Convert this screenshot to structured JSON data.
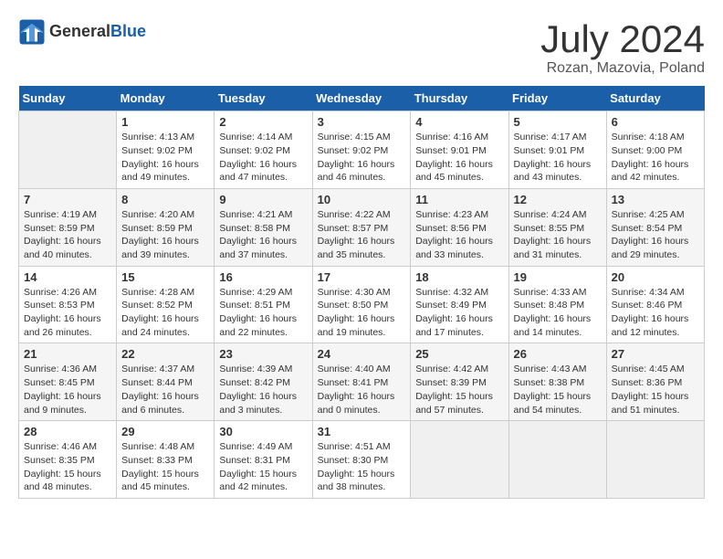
{
  "header": {
    "logo_general": "General",
    "logo_blue": "Blue",
    "month_title": "July 2024",
    "subtitle": "Rozan, Mazovia, Poland"
  },
  "weekdays": [
    "Sunday",
    "Monday",
    "Tuesday",
    "Wednesday",
    "Thursday",
    "Friday",
    "Saturday"
  ],
  "weeks": [
    [
      {
        "day": "",
        "info": ""
      },
      {
        "day": "1",
        "info": "Sunrise: 4:13 AM\nSunset: 9:02 PM\nDaylight: 16 hours\nand 49 minutes."
      },
      {
        "day": "2",
        "info": "Sunrise: 4:14 AM\nSunset: 9:02 PM\nDaylight: 16 hours\nand 47 minutes."
      },
      {
        "day": "3",
        "info": "Sunrise: 4:15 AM\nSunset: 9:02 PM\nDaylight: 16 hours\nand 46 minutes."
      },
      {
        "day": "4",
        "info": "Sunrise: 4:16 AM\nSunset: 9:01 PM\nDaylight: 16 hours\nand 45 minutes."
      },
      {
        "day": "5",
        "info": "Sunrise: 4:17 AM\nSunset: 9:01 PM\nDaylight: 16 hours\nand 43 minutes."
      },
      {
        "day": "6",
        "info": "Sunrise: 4:18 AM\nSunset: 9:00 PM\nDaylight: 16 hours\nand 42 minutes."
      }
    ],
    [
      {
        "day": "7",
        "info": "Sunrise: 4:19 AM\nSunset: 8:59 PM\nDaylight: 16 hours\nand 40 minutes."
      },
      {
        "day": "8",
        "info": "Sunrise: 4:20 AM\nSunset: 8:59 PM\nDaylight: 16 hours\nand 39 minutes."
      },
      {
        "day": "9",
        "info": "Sunrise: 4:21 AM\nSunset: 8:58 PM\nDaylight: 16 hours\nand 37 minutes."
      },
      {
        "day": "10",
        "info": "Sunrise: 4:22 AM\nSunset: 8:57 PM\nDaylight: 16 hours\nand 35 minutes."
      },
      {
        "day": "11",
        "info": "Sunrise: 4:23 AM\nSunset: 8:56 PM\nDaylight: 16 hours\nand 33 minutes."
      },
      {
        "day": "12",
        "info": "Sunrise: 4:24 AM\nSunset: 8:55 PM\nDaylight: 16 hours\nand 31 minutes."
      },
      {
        "day": "13",
        "info": "Sunrise: 4:25 AM\nSunset: 8:54 PM\nDaylight: 16 hours\nand 29 minutes."
      }
    ],
    [
      {
        "day": "14",
        "info": "Sunrise: 4:26 AM\nSunset: 8:53 PM\nDaylight: 16 hours\nand 26 minutes."
      },
      {
        "day": "15",
        "info": "Sunrise: 4:28 AM\nSunset: 8:52 PM\nDaylight: 16 hours\nand 24 minutes."
      },
      {
        "day": "16",
        "info": "Sunrise: 4:29 AM\nSunset: 8:51 PM\nDaylight: 16 hours\nand 22 minutes."
      },
      {
        "day": "17",
        "info": "Sunrise: 4:30 AM\nSunset: 8:50 PM\nDaylight: 16 hours\nand 19 minutes."
      },
      {
        "day": "18",
        "info": "Sunrise: 4:32 AM\nSunset: 8:49 PM\nDaylight: 16 hours\nand 17 minutes."
      },
      {
        "day": "19",
        "info": "Sunrise: 4:33 AM\nSunset: 8:48 PM\nDaylight: 16 hours\nand 14 minutes."
      },
      {
        "day": "20",
        "info": "Sunrise: 4:34 AM\nSunset: 8:46 PM\nDaylight: 16 hours\nand 12 minutes."
      }
    ],
    [
      {
        "day": "21",
        "info": "Sunrise: 4:36 AM\nSunset: 8:45 PM\nDaylight: 16 hours\nand 9 minutes."
      },
      {
        "day": "22",
        "info": "Sunrise: 4:37 AM\nSunset: 8:44 PM\nDaylight: 16 hours\nand 6 minutes."
      },
      {
        "day": "23",
        "info": "Sunrise: 4:39 AM\nSunset: 8:42 PM\nDaylight: 16 hours\nand 3 minutes."
      },
      {
        "day": "24",
        "info": "Sunrise: 4:40 AM\nSunset: 8:41 PM\nDaylight: 16 hours\nand 0 minutes."
      },
      {
        "day": "25",
        "info": "Sunrise: 4:42 AM\nSunset: 8:39 PM\nDaylight: 15 hours\nand 57 minutes."
      },
      {
        "day": "26",
        "info": "Sunrise: 4:43 AM\nSunset: 8:38 PM\nDaylight: 15 hours\nand 54 minutes."
      },
      {
        "day": "27",
        "info": "Sunrise: 4:45 AM\nSunset: 8:36 PM\nDaylight: 15 hours\nand 51 minutes."
      }
    ],
    [
      {
        "day": "28",
        "info": "Sunrise: 4:46 AM\nSunset: 8:35 PM\nDaylight: 15 hours\nand 48 minutes."
      },
      {
        "day": "29",
        "info": "Sunrise: 4:48 AM\nSunset: 8:33 PM\nDaylight: 15 hours\nand 45 minutes."
      },
      {
        "day": "30",
        "info": "Sunrise: 4:49 AM\nSunset: 8:31 PM\nDaylight: 15 hours\nand 42 minutes."
      },
      {
        "day": "31",
        "info": "Sunrise: 4:51 AM\nSunset: 8:30 PM\nDaylight: 15 hours\nand 38 minutes."
      },
      {
        "day": "",
        "info": ""
      },
      {
        "day": "",
        "info": ""
      },
      {
        "day": "",
        "info": ""
      }
    ]
  ]
}
